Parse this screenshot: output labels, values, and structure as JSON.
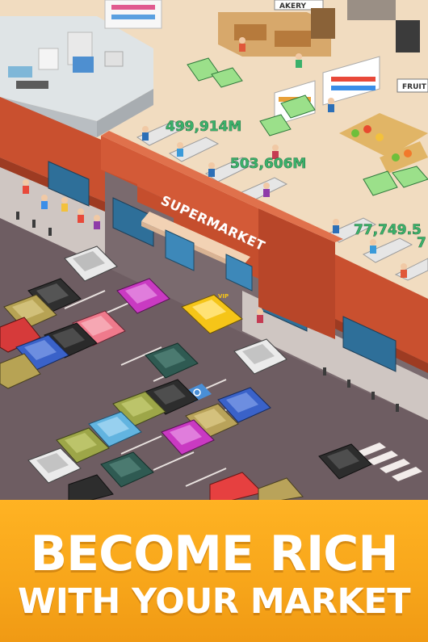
{
  "store": {
    "sign_label": "SUPERMARKET",
    "bakery_label": "AKERY",
    "fruit_label": "FRUIT",
    "vip_label": "VIP"
  },
  "hud": {
    "money_popups": [
      "499,914M",
      "503,606M",
      "77,749.5",
      "7"
    ]
  },
  "banner": {
    "line1": "BECOME RICH",
    "line2": "WITH YOUR MARKET"
  },
  "colors": {
    "wall_brick": "#c9502f",
    "floor": "#f1dcc0",
    "asphalt": "#6b5c60",
    "banner": "#f7a51a",
    "money_text": "#3bb06a"
  },
  "icons": {
    "accessible": "wheelchair-icon",
    "cash": "cash-stack-icon"
  }
}
